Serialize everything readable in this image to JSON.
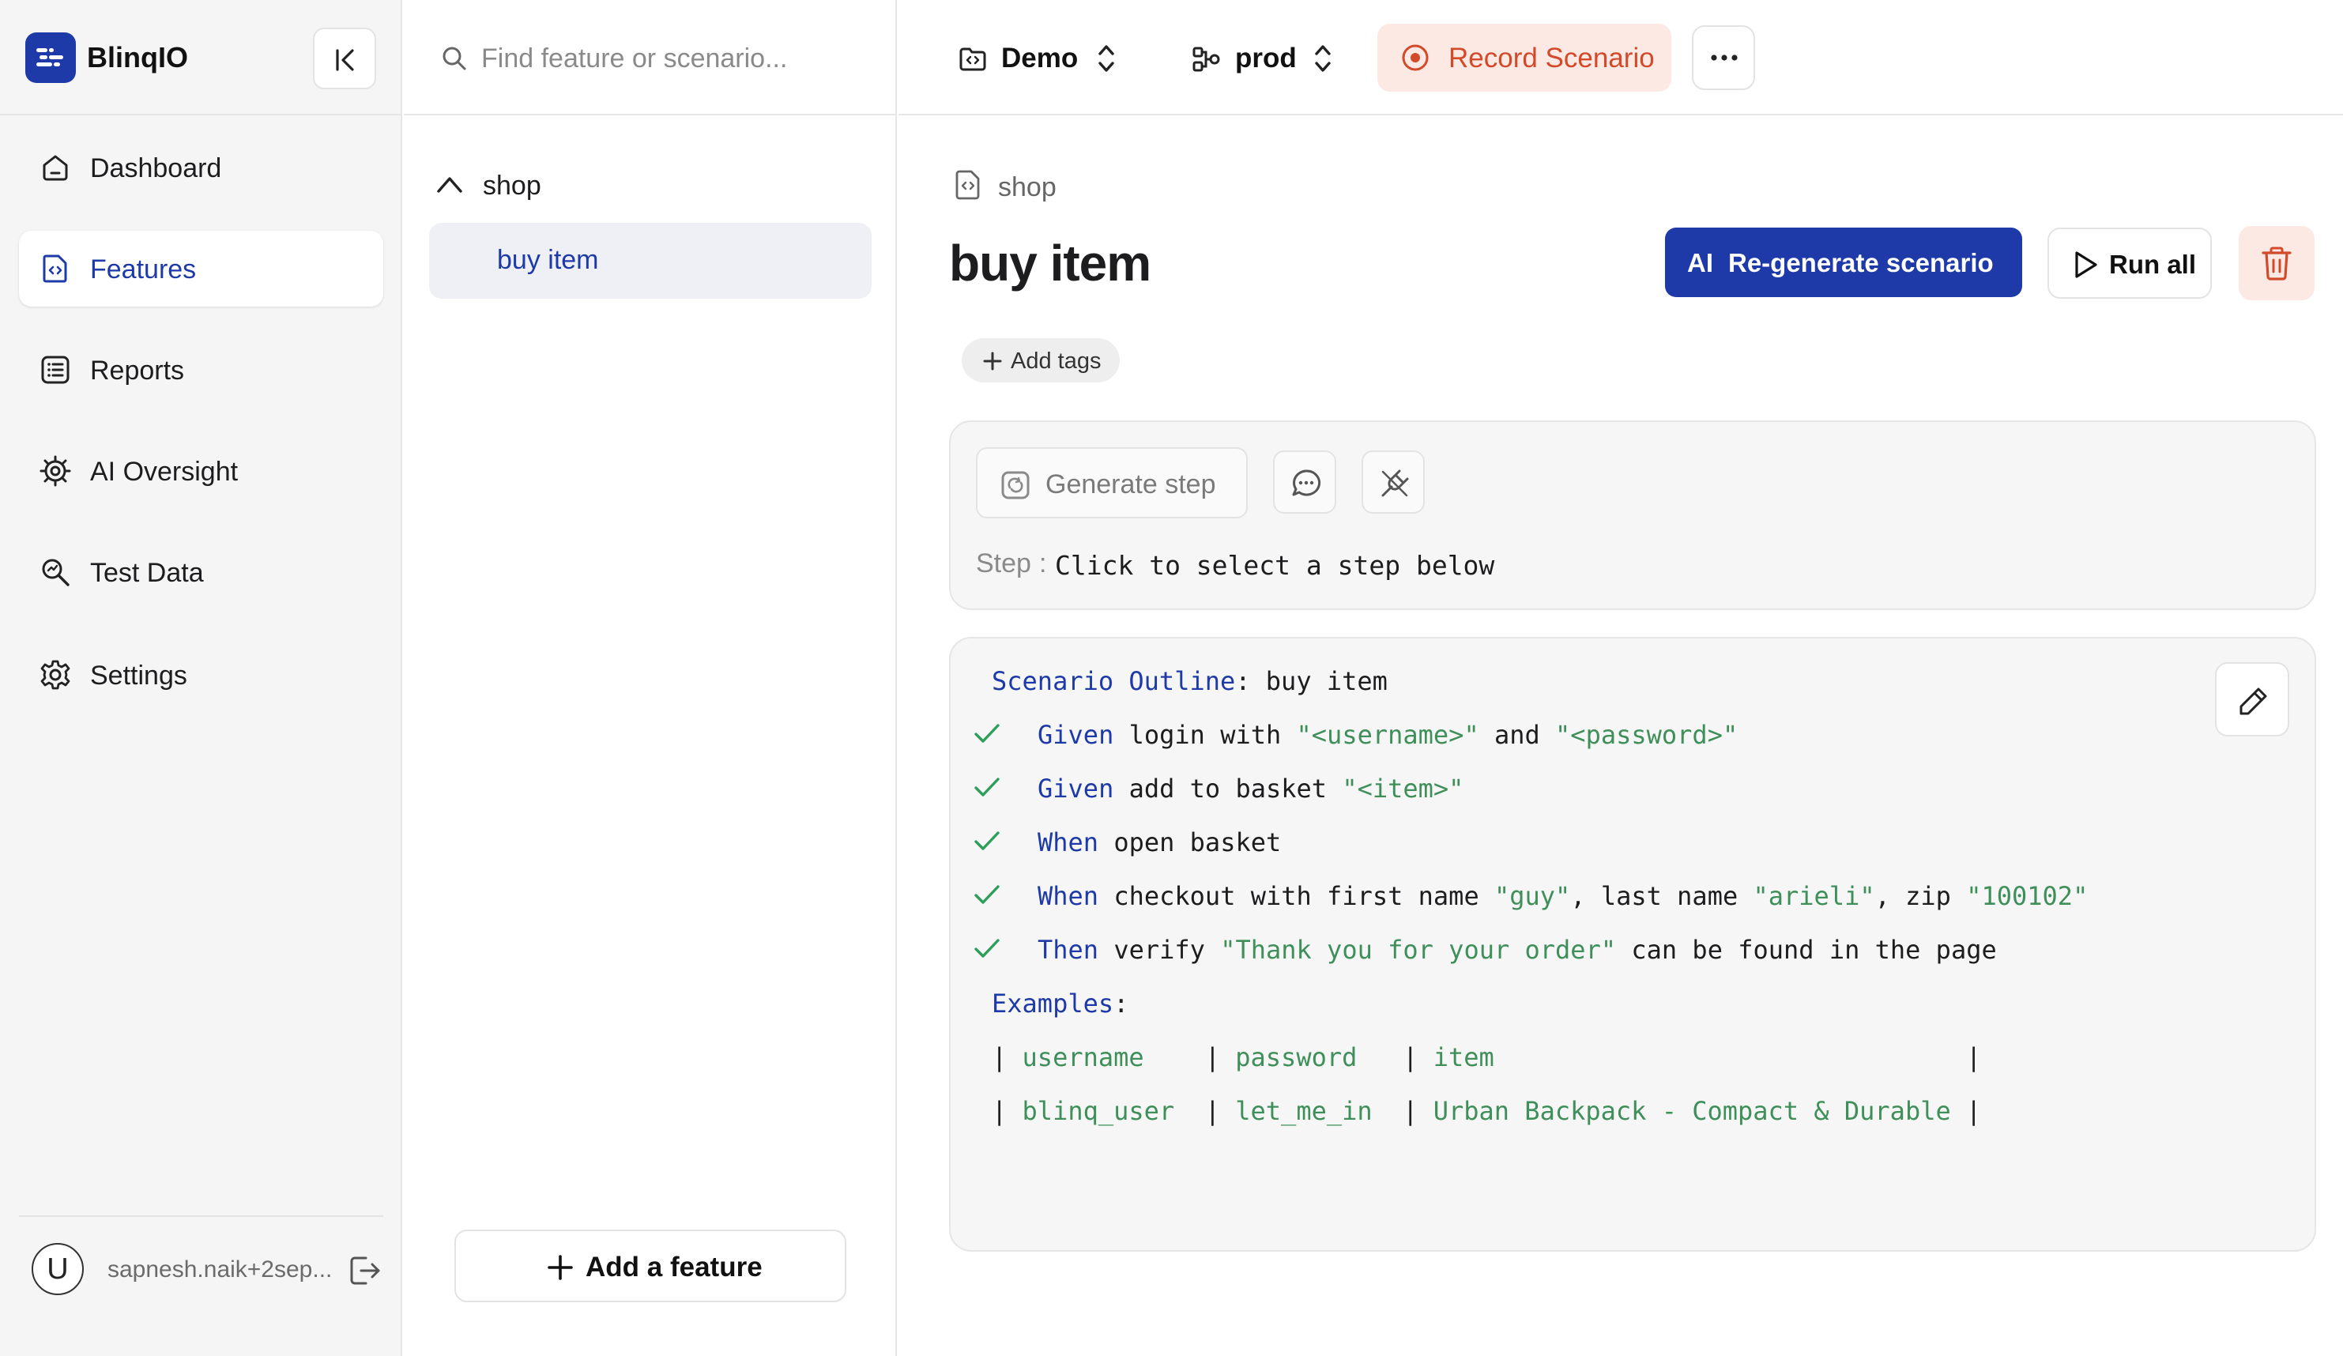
{
  "brand": {
    "name": "BlinqIO"
  },
  "sidebar": {
    "items": [
      {
        "label": "Dashboard",
        "icon": "home-icon"
      },
      {
        "label": "Features",
        "icon": "file-code-icon",
        "active": true
      },
      {
        "label": "Reports",
        "icon": "list-icon"
      },
      {
        "label": "AI Oversight",
        "icon": "chip-icon"
      },
      {
        "label": "Test Data",
        "icon": "search-data-icon"
      },
      {
        "label": "Settings",
        "icon": "gear-icon"
      }
    ],
    "user": {
      "avatar_letter": "U",
      "email": "sapnesh.naik+2sep..."
    }
  },
  "feature_panel": {
    "search_placeholder": "Find feature or scenario...",
    "folder": {
      "label": "shop",
      "expanded": true
    },
    "selected_item": "buy item",
    "add_feature_label": "Add a feature"
  },
  "topbar": {
    "project": "Demo",
    "environment": "prod",
    "record_label": "Record Scenario"
  },
  "main": {
    "breadcrumb": "shop",
    "title": "buy item",
    "regen_ai": "AI",
    "regen_label": "Re-generate scenario",
    "run_all_label": "Run all",
    "add_tags_label": "Add tags",
    "step_panel": {
      "generate_label": "Generate step",
      "step_prefix": "Step",
      "step_sep": ":",
      "step_text": "Click to select a step below"
    },
    "scenario": {
      "outline_keyword": "Scenario Outline",
      "outline_colon": ":",
      "outline_name": "buy item",
      "steps": [
        {
          "keyword": "Given",
          "parts": [
            "login with ",
            "\"<username>\"",
            " and ",
            "\"<password>\""
          ]
        },
        {
          "keyword": "Given",
          "parts": [
            "add to basket ",
            "\"<item>\""
          ]
        },
        {
          "keyword": "When",
          "parts": [
            "open basket"
          ]
        },
        {
          "keyword": "When",
          "parts": [
            "checkout with first name ",
            "\"guy\"",
            ", last name ",
            "\"arieli\"",
            ", zip ",
            "\"100102\""
          ]
        },
        {
          "keyword": "Then",
          "parts": [
            "verify ",
            "\"Thank you for your order\"",
            " can be found in the page"
          ]
        }
      ],
      "examples_keyword": "Examples",
      "examples_colon": ":",
      "table_header": [
        "username",
        "password",
        "item"
      ],
      "table_row": [
        "blinq_user",
        "let_me_in",
        "Urban Backpack - Compact & Durable"
      ]
    }
  },
  "colors": {
    "brand": "#1e3aa8",
    "record": "#d24a2a",
    "keyword": "#1e3aa8",
    "string": "#3f8f5a",
    "check": "#2e9e5b"
  }
}
